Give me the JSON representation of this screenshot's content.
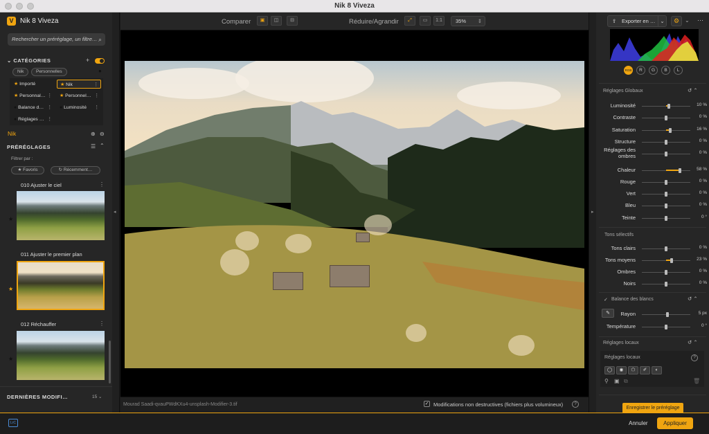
{
  "window": {
    "title": "Nik 8 Viveza"
  },
  "app": {
    "name": "Nik 8 Viveza",
    "logo_letter": "V"
  },
  "colors": {
    "accent": "#f0a510",
    "background": "#1b1b1b",
    "panel": "#262626"
  },
  "search": {
    "placeholder": "Rechercher un préréglage, un filtre…"
  },
  "categories": {
    "title": "CATÉGORIES",
    "filters": [
      "Nik",
      "Personnelles"
    ],
    "items": [
      {
        "label": "Importé",
        "starred": true,
        "selected": false
      },
      {
        "label": "Nik",
        "starred": true,
        "selected": true
      },
      {
        "label": "Personnal…",
        "starred": true,
        "selected": false
      },
      {
        "label": "Personnel…",
        "starred": true,
        "selected": false
      },
      {
        "label": "Balance d…",
        "starred": false,
        "selected": false
      },
      {
        "label": "Luminosité",
        "starred": false,
        "selected": false
      },
      {
        "label": "Réglages …",
        "starred": false,
        "selected": false
      }
    ]
  },
  "current_category": "Nik",
  "presets": {
    "title": "PRÉRÉGLAGES",
    "filter_label": "Filtrer par :",
    "filter_buttons": [
      "Favoris",
      "Récemment…"
    ],
    "items": [
      {
        "label": "010 Ajuster le ciel",
        "favorite": false,
        "selected": false
      },
      {
        "label": "011 Ajuster le premier plan",
        "favorite": true,
        "selected": true
      },
      {
        "label": "012 Réchauffer",
        "favorite": false,
        "selected": false
      }
    ]
  },
  "last_modified": {
    "title": "DERNIÈRES MODIFI…",
    "count": "15"
  },
  "toolbar": {
    "compare_label": "Comparer",
    "zoom_label": "Réduire/Agrandir",
    "one_to_one": "1:1",
    "zoom_value": "35%"
  },
  "status": {
    "filename": "Mourad Saadi-qvauPWdKXu4-unsplash-Modifier-3.tif",
    "non_destructive": "Modifications non destructives (fichiers plus volumineux)",
    "non_destructive_checked": true
  },
  "right": {
    "export_label": "Exporter en …",
    "channels": [
      "RGB",
      "R",
      "G",
      "B",
      "L"
    ],
    "active_channel": "RGB",
    "global": {
      "title": "Réglages Globaux",
      "sliders": [
        {
          "label": "Luminosité",
          "value": "10 %",
          "level": 0.1
        },
        {
          "label": "Contraste",
          "value": "0 %",
          "level": 0
        },
        {
          "label": "Saturation",
          "value": "16 %",
          "level": 0.16
        },
        {
          "label": "Structure",
          "value": "0 %",
          "level": 0
        },
        {
          "label": "Réglages des ombres",
          "value": "0 %",
          "level": 0
        },
        {
          "label": "Chaleur",
          "value": "58 %",
          "level": 0.58
        },
        {
          "label": "Rouge",
          "value": "0 %",
          "level": 0
        },
        {
          "label": "Vert",
          "value": "0 %",
          "level": 0
        },
        {
          "label": "Bleu",
          "value": "0 %",
          "level": 0
        },
        {
          "label": "Teinte",
          "value": "0 °",
          "level": 0
        }
      ]
    },
    "selective": {
      "title": "Tons sélectifs",
      "sliders": [
        {
          "label": "Tons clairs",
          "value": "0 %",
          "level": 0
        },
        {
          "label": "Tons moyens",
          "value": "23 %",
          "level": 0.23
        },
        {
          "label": "Ombres",
          "value": "0 %",
          "level": 0
        },
        {
          "label": "Noirs",
          "value": "0 %",
          "level": 0
        }
      ]
    },
    "white_balance": {
      "title": "Balance des blancs",
      "sliders": [
        {
          "label": "Rayon",
          "value": "5 px",
          "level": 0.05
        },
        {
          "label": "Température",
          "value": "0 °",
          "level": 0
        }
      ]
    },
    "local": {
      "title": "Réglages locaux",
      "subtitle": "Réglages locaux"
    },
    "save_preset": "Enregistrer le préréglage"
  },
  "footer": {
    "lrc": "LrC",
    "cancel": "Annuler",
    "apply": "Appliquer"
  }
}
